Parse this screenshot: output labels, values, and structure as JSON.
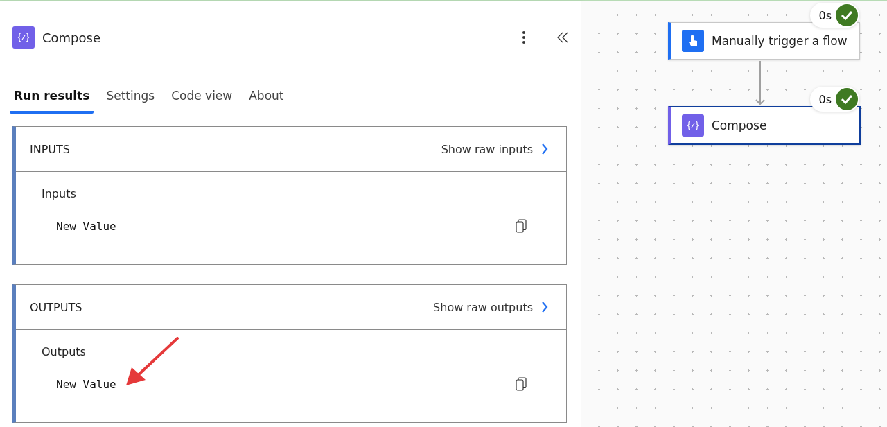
{
  "panel": {
    "title": "Compose",
    "tabs": [
      {
        "label": "Run results",
        "selected": true
      },
      {
        "label": "Settings",
        "selected": false
      },
      {
        "label": "Code view",
        "selected": false
      },
      {
        "label": "About",
        "selected": false
      }
    ],
    "sections": [
      {
        "heading": "INPUTS",
        "link": "Show raw inputs",
        "field_label": "Inputs",
        "value": "New Value"
      },
      {
        "heading": "OUTPUTS",
        "link": "Show raw outputs",
        "field_label": "Outputs",
        "value": "New Value"
      }
    ]
  },
  "canvas": {
    "nodes": [
      {
        "kind": "trigger",
        "title": "Manually trigger a flow",
        "duration": "0s",
        "selected": false
      },
      {
        "kind": "action",
        "title": "Compose",
        "duration": "0s",
        "selected": true
      }
    ]
  }
}
